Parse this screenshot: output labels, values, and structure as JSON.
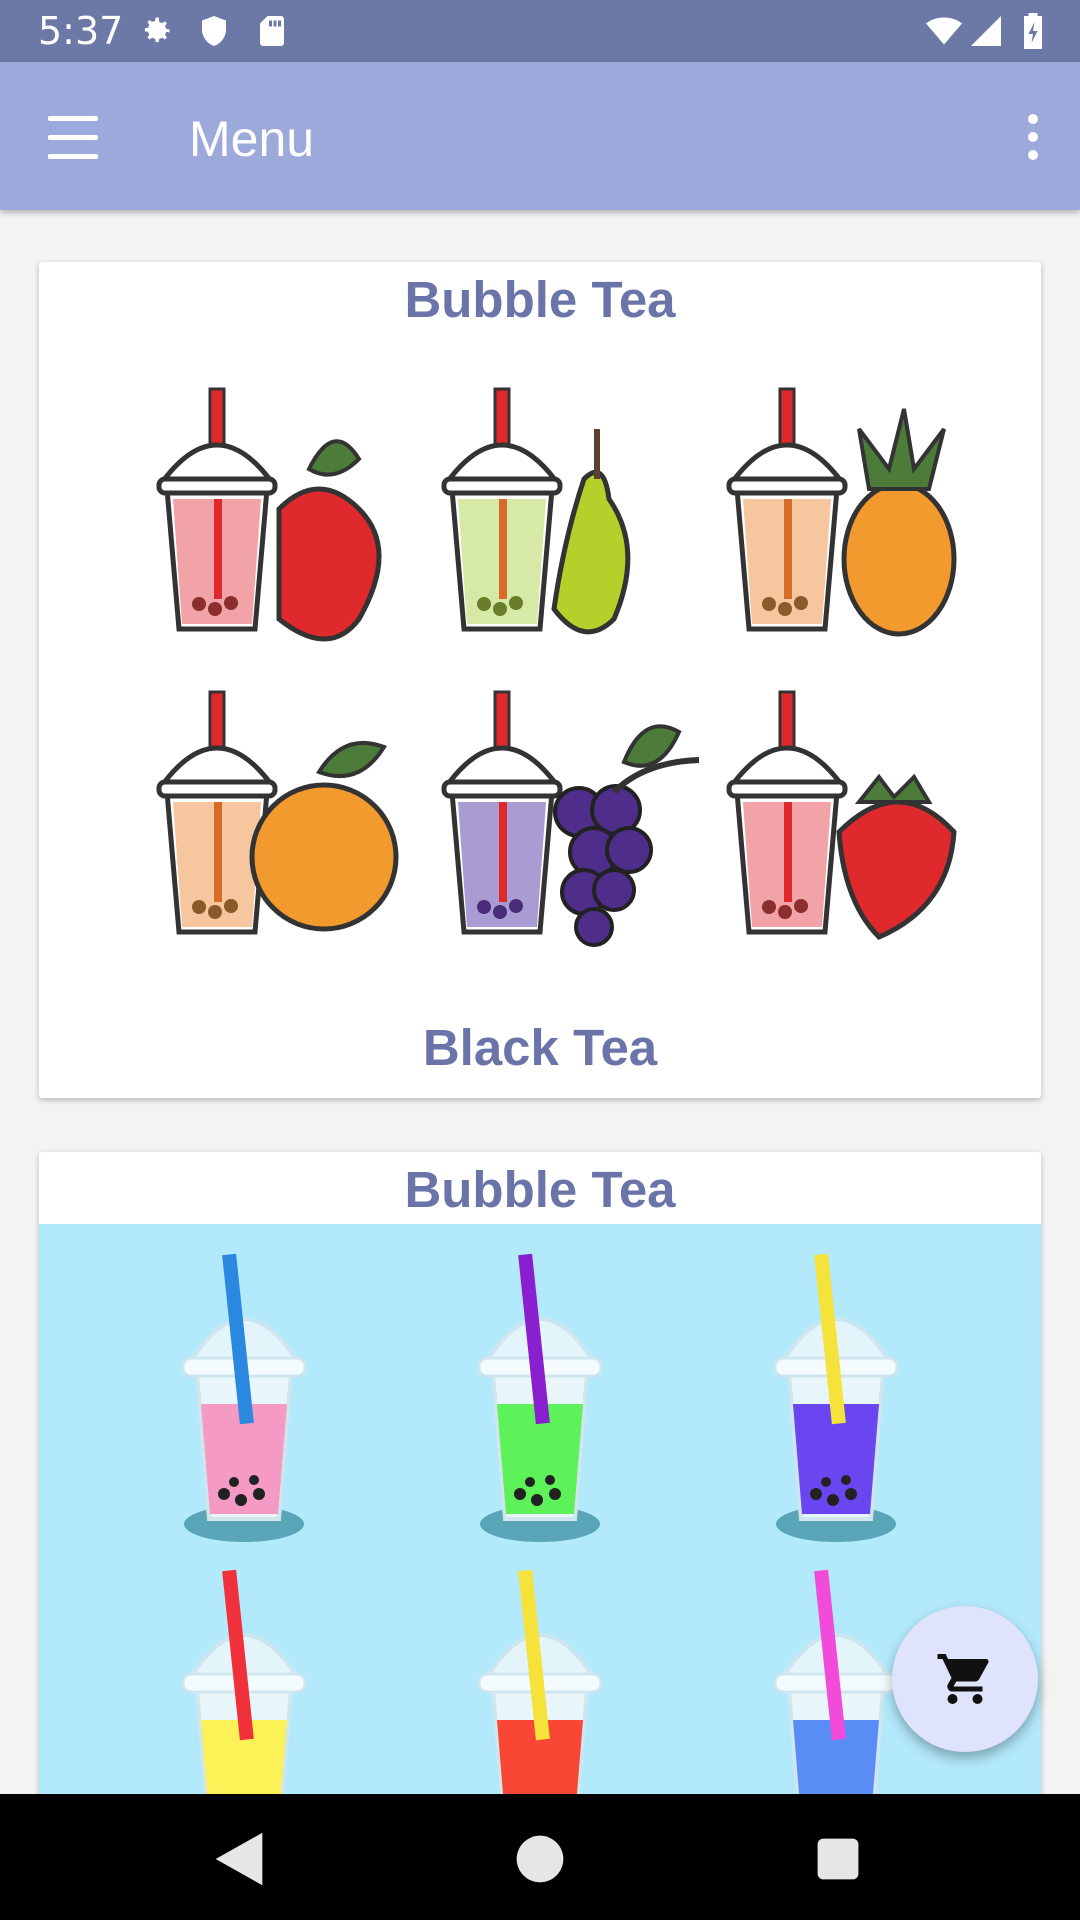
{
  "status_bar": {
    "time": "5:37",
    "icons": [
      "settings-icon",
      "shield-icon",
      "sd-card-icon",
      "wifi-icon",
      "signal-icon",
      "battery-icon"
    ]
  },
  "app_bar": {
    "title": "Menu",
    "nav_icon": "hamburger-menu-icon",
    "overflow_icon": "more-vert-icon",
    "background": "#9da8db"
  },
  "menu_cards": [
    {
      "title": "Bubble Tea",
      "subtitle": "Black Tea",
      "image_background": "#cccccc",
      "items": [
        {
          "fruit": "apple",
          "drink_color": "#f2a3a8"
        },
        {
          "fruit": "pear",
          "drink_color": "#d7e9a6"
        },
        {
          "fruit": "pineapple",
          "drink_color": "#f6c79e"
        },
        {
          "fruit": "orange",
          "drink_color": "#f6c79e"
        },
        {
          "fruit": "grape",
          "drink_color": "#a99cd2"
        },
        {
          "fruit": "strawberry",
          "drink_color": "#f2a3a8"
        }
      ]
    },
    {
      "title": "Bubble Tea",
      "image_background": "#b2e9fb",
      "items": [
        {
          "straw": "#2a88e0",
          "drink": "#f49ac4"
        },
        {
          "straw": "#8a1fcf",
          "drink": "#5ef25a"
        },
        {
          "straw": "#f5e33b",
          "drink": "#6a46f0"
        },
        {
          "straw": "#f0303a",
          "drink": "#fbf257"
        },
        {
          "straw": "#f5e33b",
          "drink": "#fa4635"
        },
        {
          "straw": "#f24ad9",
          "drink": "#5a8cf5"
        }
      ]
    }
  ],
  "fab": {
    "icon": "shopping-cart-icon",
    "background": "#dfe3fb"
  },
  "nav_bar": {
    "icons": [
      "back-icon",
      "home-icon",
      "recents-icon"
    ]
  }
}
